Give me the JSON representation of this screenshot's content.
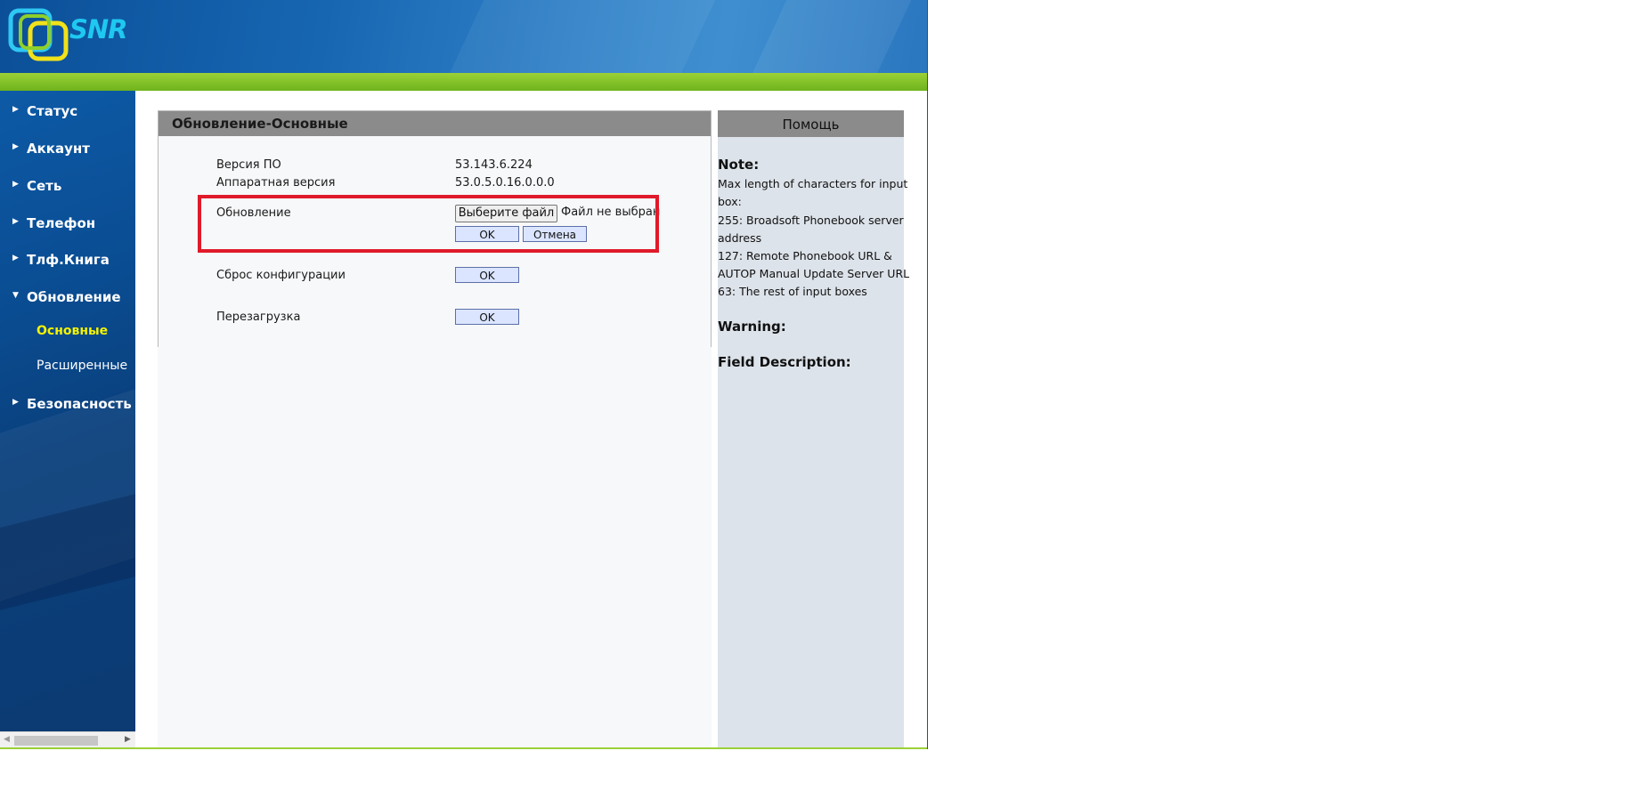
{
  "header": {
    "logo_text": "SNR"
  },
  "sidebar": {
    "items": [
      {
        "label": "Статус"
      },
      {
        "label": "Аккаунт"
      },
      {
        "label": "Сеть"
      },
      {
        "label": "Телефон"
      },
      {
        "label": "Тлф.Книга"
      },
      {
        "label": "Обновление"
      },
      {
        "label": "Безопасность"
      }
    ],
    "subitems": [
      {
        "label": "Основные",
        "active": true
      },
      {
        "label": "Расширенные",
        "active": false
      }
    ]
  },
  "panel": {
    "title": "Обновление-Основные",
    "firmware_label": "Версия ПО",
    "firmware_value": "53.143.6.224",
    "hardware_label": "Аппаратная версия",
    "hardware_value": "53.0.5.0.16.0.0.0",
    "upgrade_label": "Обновление",
    "choose_file_label": "Выберите файл",
    "no_file_label": "Файл не выбран",
    "ok_label": "OK",
    "cancel_label": "Отмена",
    "reset_label": "Сброс конфигурации",
    "reboot_label": "Перезагрузка"
  },
  "help": {
    "title": "Помощь",
    "note_title": "Note:",
    "note_lines": [
      "Max length of characters for input",
      "box:",
      "255: Broadsoft Phonebook server",
      "address",
      "127: Remote Phonebook URL &",
      "AUTOP Manual Update Server URL",
      "63: The rest of input boxes"
    ],
    "warning_title": "Warning:",
    "field_title": "Field Description:"
  },
  "colors": {
    "header_blue": "#1766b2",
    "green_bar": "#7fc22a",
    "active_menu": "#f4f200",
    "highlight_red": "#e01a2a",
    "button_fill": "#dbe5ff"
  }
}
